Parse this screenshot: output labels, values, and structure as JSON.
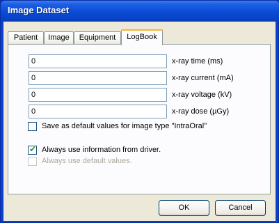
{
  "window": {
    "title": "Image Dataset"
  },
  "tabs": [
    {
      "label": "Patient"
    },
    {
      "label": "Image"
    },
    {
      "label": "Equipment"
    },
    {
      "label": "LogBook"
    }
  ],
  "active_tab": "LogBook",
  "fields": [
    {
      "label": "x-ray time (ms)",
      "value": "0"
    },
    {
      "label": "x-ray current (mA)",
      "value": "0"
    },
    {
      "label": "x-ray voltage (kV)",
      "value": "0"
    },
    {
      "label": "x-ray dose (µGy)",
      "value": "0"
    }
  ],
  "checkboxes": {
    "save_default": {
      "label": "Save as default values for image type \"IntraOral\"",
      "checked": false,
      "enabled": true
    },
    "use_driver": {
      "label": "Always use information from driver.",
      "checked": true,
      "enabled": true
    },
    "use_default": {
      "label": "Always use default values.",
      "checked": false,
      "enabled": false
    }
  },
  "buttons": {
    "ok": "OK",
    "cancel": "Cancel"
  },
  "colors": {
    "title_bar": "#0a4bd6",
    "active_tab_accent": "#f8b33a",
    "dialog_bg": "#ece9d8",
    "checkmark": "#21a121"
  }
}
